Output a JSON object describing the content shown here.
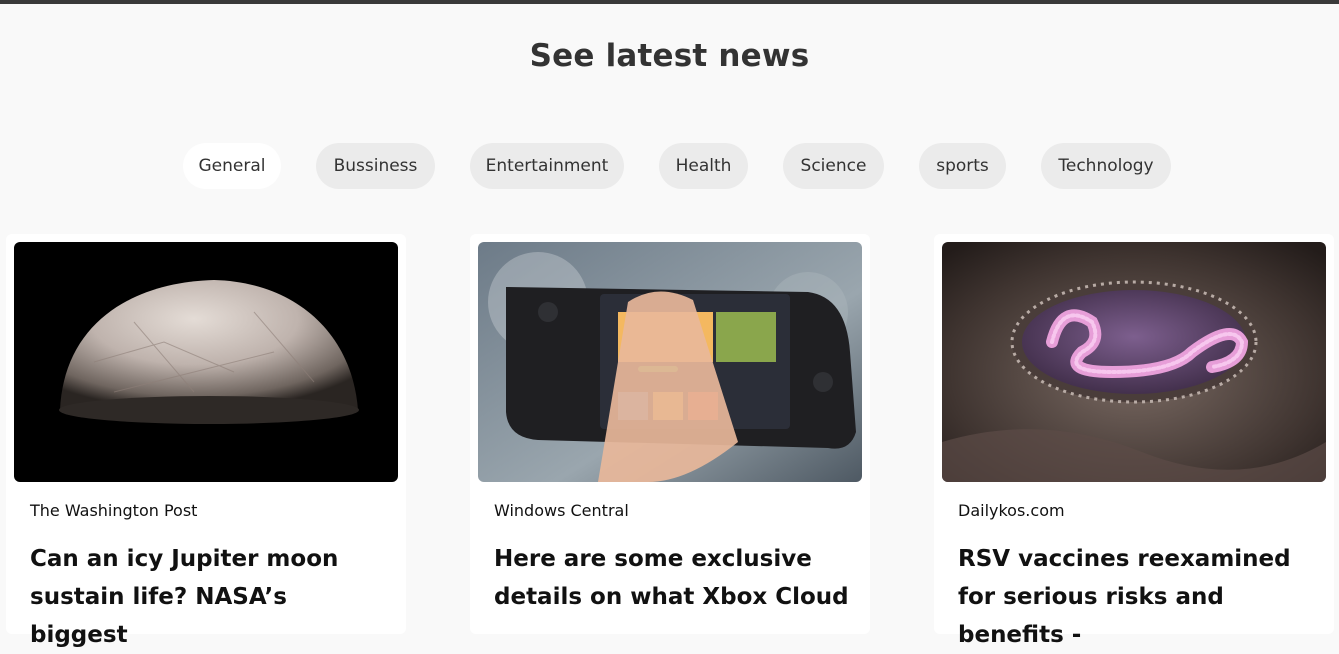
{
  "heading": "See latest news",
  "tabs": [
    {
      "label": "General",
      "active": true
    },
    {
      "label": "Bussiness",
      "active": false
    },
    {
      "label": "Entertainment",
      "active": false
    },
    {
      "label": "Health",
      "active": false
    },
    {
      "label": "Science",
      "active": false
    },
    {
      "label": "sports",
      "active": false
    },
    {
      "label": "Technology",
      "active": false
    }
  ],
  "cards": [
    {
      "source": "The Washington Post",
      "title": "Can an icy Jupiter moon sustain life? NASA’s biggest",
      "image": "icy-moon-image"
    },
    {
      "source": "Windows Central",
      "title": "Here are some exclusive details on what Xbox Cloud",
      "image": "handheld-console-image"
    },
    {
      "source": "Dailykos.com",
      "title": "RSV vaccines reexamined for serious risks and benefits -",
      "image": "virus-bacterium-image"
    }
  ],
  "colors": {
    "page_background": "#f9f9f9",
    "tab_background": "#ebebeb",
    "tab_active_background": "#ffffff",
    "top_bar": "#3a3a3a"
  }
}
